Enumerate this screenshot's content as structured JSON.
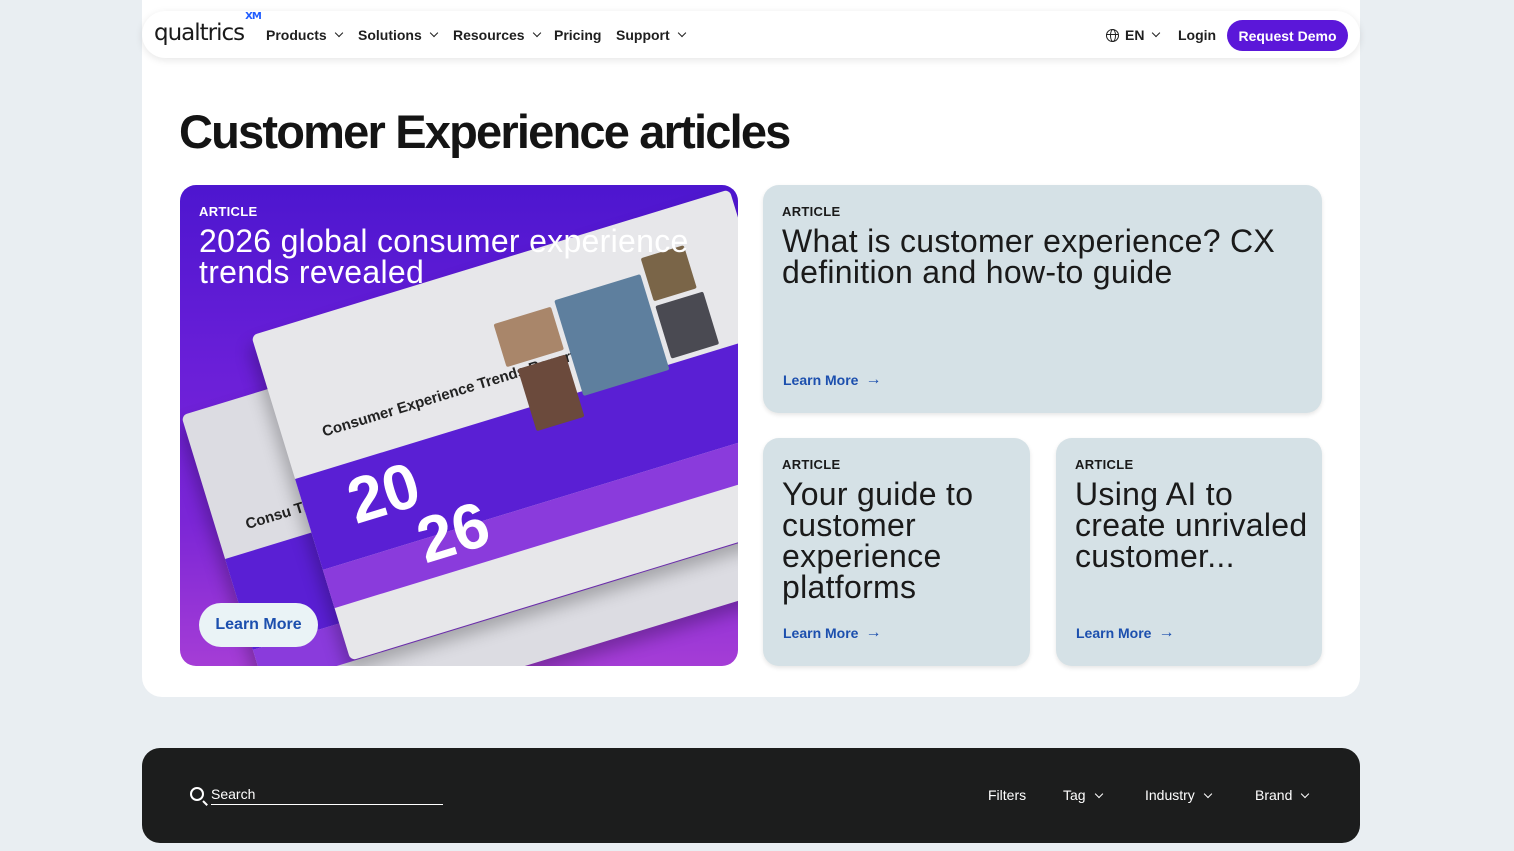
{
  "nav": {
    "logo": "qualtrics",
    "logo_sup": "XM",
    "items": [
      {
        "label": "Products",
        "dropdown": true
      },
      {
        "label": "Solutions",
        "dropdown": true
      },
      {
        "label": "Resources",
        "dropdown": true
      },
      {
        "label": "Pricing",
        "dropdown": false
      },
      {
        "label": "Support",
        "dropdown": true
      }
    ],
    "language": "EN",
    "login": "Login",
    "demo": "Request Demo"
  },
  "page_title": "Customer Experience articles",
  "featured": {
    "eyebrow": "ARTICLE",
    "title": "2026 global consumer experience trends revealed",
    "image": {
      "text": "Consumer Experience Trends Report",
      "year_top": "20",
      "year_bottom": "26",
      "back_text": "Consu Trend"
    },
    "cta": "Learn More"
  },
  "cards": [
    {
      "eyebrow": "ARTICLE",
      "title": "What is customer experience? CX definition and how-to guide",
      "cta": "Learn More"
    },
    {
      "eyebrow": "ARTICLE",
      "title": "Your guide to customer experience platforms",
      "cta": "Learn More"
    },
    {
      "eyebrow": "ARTICLE",
      "title": "Using AI to create unrivaled customer...",
      "cta": "Learn More"
    }
  ],
  "search": {
    "placeholder": "Search",
    "filters_label": "Filters",
    "dropdowns": [
      "Tag",
      "Industry",
      "Brand"
    ]
  },
  "colors": {
    "brand_purple": "#5b17d9",
    "link_blue": "#1c4fae",
    "card_grey": "#d5e1e6",
    "dark_bar": "#1c1d1d"
  }
}
